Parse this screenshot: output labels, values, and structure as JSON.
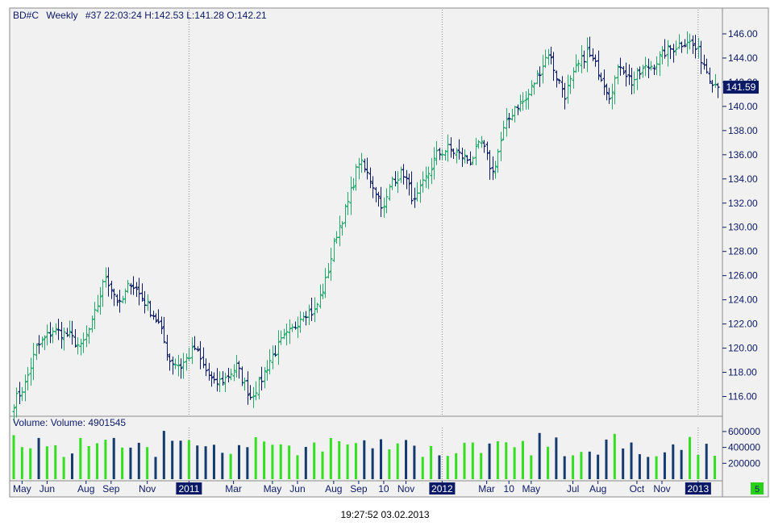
{
  "header": {
    "symbol": "BD#C",
    "period": "Weekly",
    "info": "#37 22:03:24 H:142.53 L:141.28 O:142.21"
  },
  "footer": {
    "timestamp": "19:27:52 03.02.2013"
  },
  "corner_badge": "5",
  "colors": {
    "up": "#22a86b",
    "down": "#0b1a66",
    "volume_up": "#33e01f",
    "volume_down": "#143a6e",
    "background": "#f1f1f1",
    "axis_text": "#0b1a66",
    "highlight_label": "#0b1a66"
  },
  "chart_data": [
    {
      "type": "ohlc",
      "series": "price",
      "ylim": [
        114.5,
        148
      ],
      "last_price_label": "141.59",
      "last_price": 141.59,
      "y_ticks": [
        {
          "v": 116,
          "label": "116.00"
        },
        {
          "v": 118,
          "label": "118.00"
        },
        {
          "v": 120,
          "label": "120.00"
        },
        {
          "v": 122,
          "label": "122.00"
        },
        {
          "v": 124,
          "label": "124.00"
        },
        {
          "v": 126,
          "label": "126.00"
        },
        {
          "v": 128,
          "label": "128.00"
        },
        {
          "v": 130,
          "label": "130.00"
        },
        {
          "v": 132,
          "label": "132.00"
        },
        {
          "v": 134,
          "label": "134.00"
        },
        {
          "v": 136,
          "label": "136.00"
        },
        {
          "v": 138,
          "label": "138.00"
        },
        {
          "v": 140,
          "label": "140.00"
        },
        {
          "v": 142,
          "label": "142.00"
        },
        {
          "v": 144,
          "label": "144.00"
        },
        {
          "v": 146,
          "label": "146.00"
        }
      ],
      "x_labels": [
        {
          "i": 3,
          "label": "May",
          "highlight": false
        },
        {
          "i": 12,
          "label": "Jun",
          "highlight": false
        },
        {
          "i": 26,
          "label": "Aug",
          "highlight": false
        },
        {
          "i": 35,
          "label": "Sep",
          "highlight": false
        },
        {
          "i": 48,
          "label": "Nov",
          "highlight": false
        },
        {
          "i": 63,
          "label": "2011",
          "highlight": true
        },
        {
          "i": 79,
          "label": "Mar",
          "highlight": false
        },
        {
          "i": 93,
          "label": "May",
          "highlight": false
        },
        {
          "i": 102,
          "label": "Jun",
          "highlight": false
        },
        {
          "i": 115,
          "label": "Aug",
          "highlight": false
        },
        {
          "i": 124,
          "label": "Sep",
          "highlight": false
        },
        {
          "i": 133,
          "label": "10",
          "highlight": false
        },
        {
          "i": 141,
          "label": "Nov",
          "highlight": false
        },
        {
          "i": 154,
          "label": "2012",
          "highlight": true
        },
        {
          "i": 170,
          "label": "Mar",
          "highlight": false
        },
        {
          "i": 178,
          "label": "10",
          "highlight": false
        },
        {
          "i": 186,
          "label": "May",
          "highlight": false
        },
        {
          "i": 201,
          "label": "Jul",
          "highlight": false
        },
        {
          "i": 210,
          "label": "Aug",
          "highlight": false
        },
        {
          "i": 224,
          "label": "Oct",
          "highlight": false
        },
        {
          "i": 233,
          "label": "Nov",
          "highlight": false
        },
        {
          "i": 246,
          "label": "2013",
          "highlight": true
        }
      ],
      "separators": [
        63,
        154,
        246
      ],
      "anchors": [
        [
          0,
          115.5
        ],
        [
          4,
          117
        ],
        [
          8,
          120
        ],
        [
          14,
          121.5
        ],
        [
          20,
          121
        ],
        [
          24,
          120
        ],
        [
          28,
          122
        ],
        [
          33,
          126
        ],
        [
          38,
          123.5
        ],
        [
          42,
          125.5
        ],
        [
          48,
          123.5
        ],
        [
          52,
          122
        ],
        [
          56,
          119
        ],
        [
          60,
          118.5
        ],
        [
          65,
          120
        ],
        [
          68,
          118.5
        ],
        [
          72,
          117
        ],
        [
          76,
          117.5
        ],
        [
          80,
          118.5
        ],
        [
          85,
          116
        ],
        [
          88,
          117
        ],
        [
          92,
          119
        ],
        [
          96,
          120.5
        ],
        [
          100,
          121.5
        ],
        [
          104,
          123
        ],
        [
          108,
          123
        ],
        [
          112,
          125.5
        ],
        [
          116,
          129.5
        ],
        [
          120,
          132
        ],
        [
          124,
          135.5
        ],
        [
          128,
          134
        ],
        [
          133,
          131.5
        ],
        [
          136,
          134
        ],
        [
          140,
          134.5
        ],
        [
          144,
          132
        ],
        [
          148,
          134
        ],
        [
          152,
          136
        ],
        [
          156,
          136.5
        ],
        [
          160,
          136
        ],
        [
          164,
          135.5
        ],
        [
          168,
          137
        ],
        [
          172,
          134.5
        ],
        [
          176,
          138
        ],
        [
          180,
          140
        ],
        [
          184,
          140.5
        ],
        [
          188,
          142.5
        ],
        [
          192,
          144.5
        ],
        [
          195,
          142.5
        ],
        [
          198,
          141
        ],
        [
          202,
          143
        ],
        [
          206,
          144.5
        ],
        [
          210,
          143
        ],
        [
          214,
          141
        ],
        [
          218,
          143.5
        ],
        [
          222,
          142
        ],
        [
          226,
          143
        ],
        [
          230,
          143.5
        ],
        [
          234,
          144.5
        ],
        [
          238,
          145
        ],
        [
          242,
          145.5
        ],
        [
          246,
          144.5
        ],
        [
          250,
          142.5
        ],
        [
          253,
          141.6
        ]
      ],
      "n_bars": 254
    },
    {
      "type": "bar",
      "series": "volume",
      "title": "Volume:  Volume: 4901545",
      "ylim": [
        0,
        650000
      ],
      "y_ticks": [
        {
          "v": 200000,
          "label": "200000"
        },
        {
          "v": 400000,
          "label": "400000"
        },
        {
          "v": 600000,
          "label": "600000"
        }
      ]
    }
  ]
}
